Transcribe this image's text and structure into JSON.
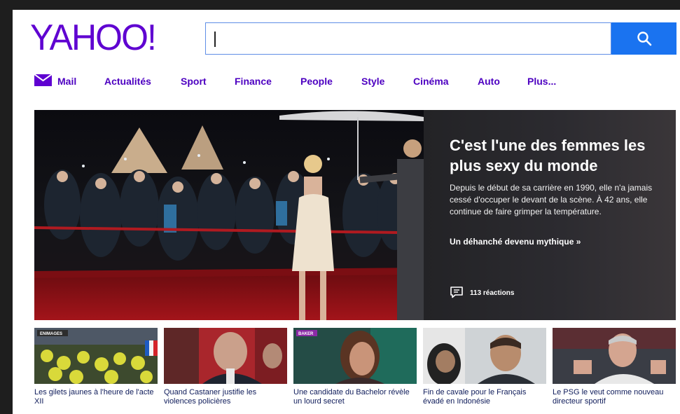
{
  "brand": {
    "logo_text": "YAHOO!",
    "color": "#5f01d1"
  },
  "search": {
    "value": "",
    "placeholder": "",
    "button_icon": "search-icon",
    "button_color": "#1a73f0"
  },
  "nav": {
    "mail_icon": "envelope-icon",
    "items": [
      {
        "label": "Mail"
      },
      {
        "label": "Actualités"
      },
      {
        "label": "Sport"
      },
      {
        "label": "Finance"
      },
      {
        "label": "People"
      },
      {
        "label": "Style"
      },
      {
        "label": "Cinéma"
      },
      {
        "label": "Auto"
      },
      {
        "label": "Plus..."
      }
    ]
  },
  "hero": {
    "title": "C'est l'une des femmes les plus sexy du monde",
    "description": "Depuis le début de sa carrière en 1990, elle n'a jamais cessé d'occuper le devant de la scène. À 42 ans, elle continue de faire grimper la température.",
    "link_text": "Un déhanché devenu mythique »",
    "reactions": "113 réactions",
    "reactions_icon": "comment-icon"
  },
  "cards": [
    {
      "caption": "Les gilets jaunes à l'heure de l'acte XII",
      "badge": "ENIMAGES"
    },
    {
      "caption": "Quand Castaner justifie les violences policières"
    },
    {
      "caption": "Une candidate du Bachelor révèle un lourd secret",
      "badge": "BAKER"
    },
    {
      "caption": "Fin de cavale pour le Français évadé en Indonésie"
    },
    {
      "caption": "Le PSG le veut comme nouveau directeur sportif"
    }
  ]
}
